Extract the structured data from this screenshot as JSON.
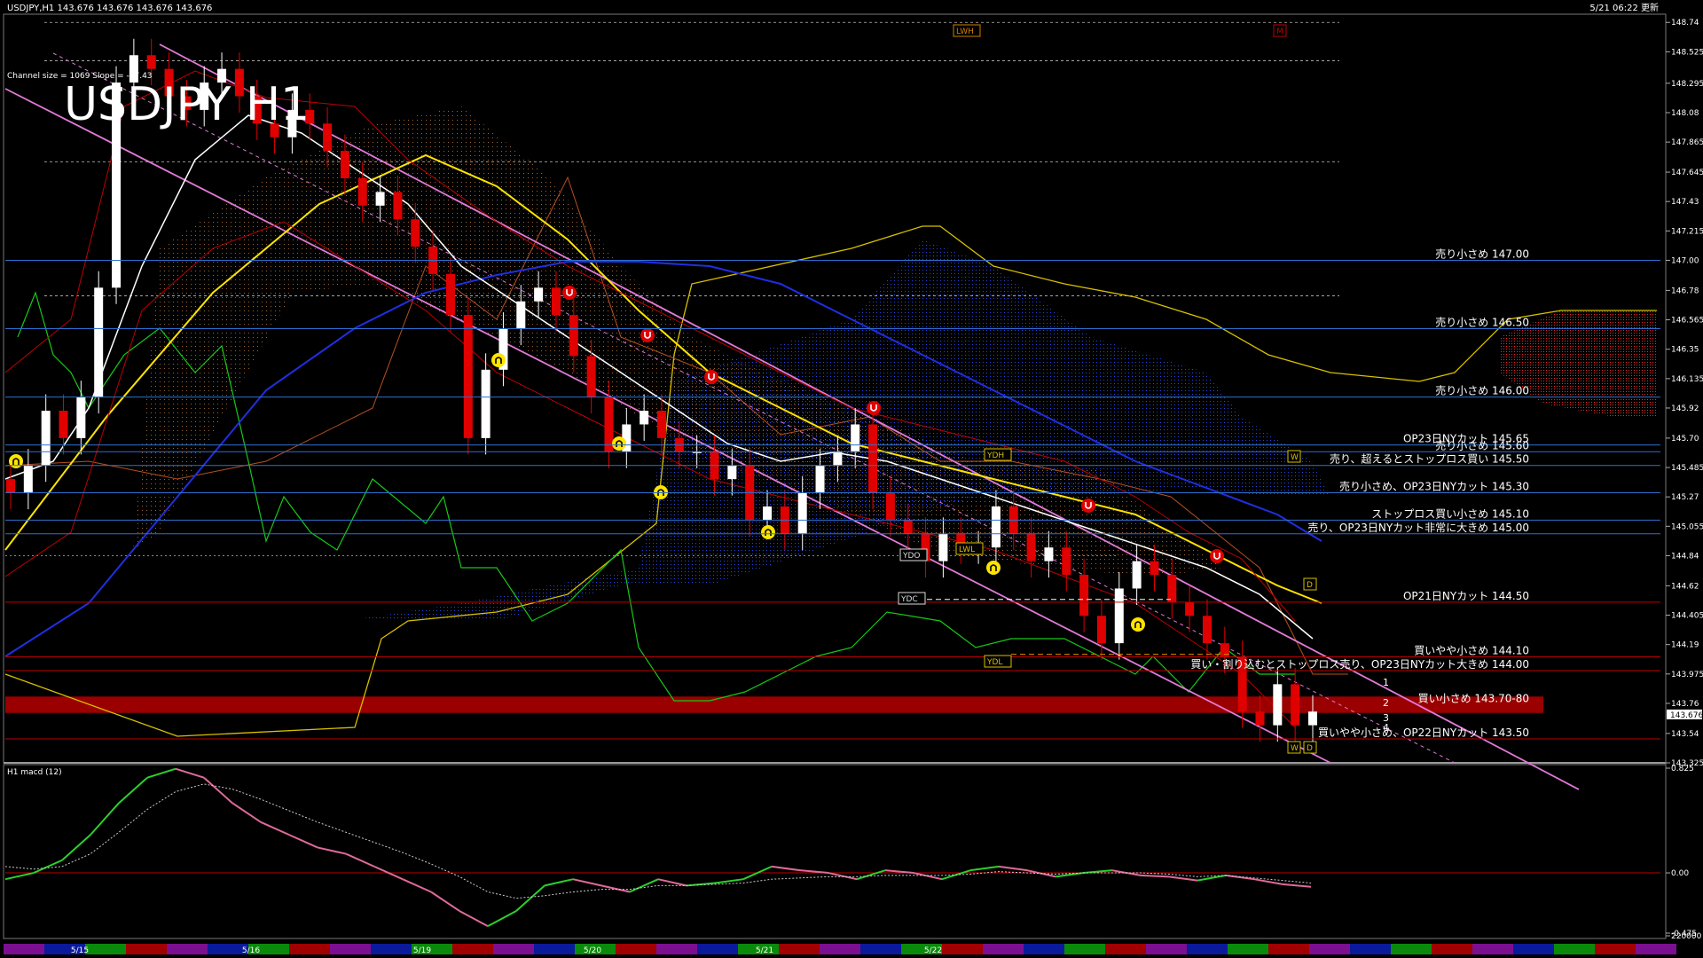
{
  "window": {
    "header_left": "USDJPY,H1  143.676 143.676 143.676 143.676",
    "header_right": "5/21 06:22 更新",
    "channel_info": "Channel size = 1069 Slope = -27.43",
    "big_title": "USDJPY H1"
  },
  "colors": {
    "background": "#000000",
    "candle_up": "#ffffff",
    "candle_down": "#e00000",
    "ma_yellow": "#ffe400",
    "ma_blue": "#1f2fe0",
    "ma_white": "#ffffff",
    "channel": "#e27ad8",
    "level_line": "#2e6fd0",
    "red_line": "#c00000",
    "zone": "#9a0000",
    "lagging": "#16c816",
    "macd_green": "#2bd12b",
    "macd_pink": "#e06a9a"
  },
  "chart_data": {
    "type": "candlestick",
    "symbol": "USDJPY",
    "timeframe": "H1",
    "ylim": [
      143.325,
      148.8
    ],
    "y_ticks": [
      148.74,
      148.525,
      148.295,
      148.08,
      147.865,
      147.645,
      147.43,
      147.215,
      147.0,
      146.78,
      146.565,
      146.35,
      146.135,
      145.92,
      145.7,
      145.485,
      145.27,
      145.055,
      144.84,
      144.62,
      144.405,
      144.19,
      143.975,
      143.76,
      143.54,
      143.325
    ],
    "current_price": "143.676",
    "x_date_labels": [
      "5/15",
      "5/16",
      "5/19",
      "5/20",
      "5/21",
      "5/22"
    ],
    "levels": [
      {
        "label": "売り小さめ 147.00",
        "price": 147.0
      },
      {
        "label": "売り小さめ 146.50",
        "price": 146.5
      },
      {
        "label": "売り小さめ 146.00",
        "price": 146.0
      },
      {
        "label": "OP23日NYカット 145.65",
        "price": 145.65
      },
      {
        "label": "売り小さめ 145.60",
        "price": 145.6
      },
      {
        "label": "売り、超えるとストップロス買い 145.50",
        "price": 145.5
      },
      {
        "label": "売り小さめ、OP23日NYカット 145.30",
        "price": 145.3
      },
      {
        "label": "ストップロス買い小さめ 145.10",
        "price": 145.1
      },
      {
        "label": "売り、OP23日NYカット非常に大きめ 145.00",
        "price": 145.0
      },
      {
        "label": "OP21日NYカット 144.50",
        "price": 144.5
      },
      {
        "label": "買いやや小さめ 144.10",
        "price": 144.1
      },
      {
        "label": "買い・割り込むとストップロス売り、OP23日NYカット大きめ 144.00",
        "price": 144.0
      },
      {
        "label": "買い小さめ 143.70-80",
        "price": 143.75
      },
      {
        "label": "買いやや小さめ、OP22日NYカット 143.50",
        "price": 143.5
      }
    ],
    "tags": [
      "LWH",
      "M",
      "YDH",
      "W",
      "YDO",
      "LWL",
      "YDC",
      "D",
      "YDL",
      "W",
      "D"
    ],
    "wave_labels": [
      "1",
      "2",
      "3",
      "4"
    ],
    "close_prices": [
      145.3,
      145.5,
      145.9,
      145.7,
      146.0,
      146.8,
      148.3,
      148.5,
      148.4,
      148.2,
      148.1,
      148.3,
      148.4,
      148.2,
      148.0,
      147.9,
      148.1,
      148.0,
      147.8,
      147.6,
      147.4,
      147.5,
      147.3,
      147.1,
      146.9,
      146.6,
      145.7,
      146.2,
      146.5,
      146.7,
      146.8,
      146.6,
      146.3,
      146.0,
      145.6,
      145.8,
      145.9,
      145.7,
      145.6,
      145.6,
      145.4,
      145.5,
      145.1,
      145.2,
      145.0,
      145.3,
      145.5,
      145.6,
      145.8,
      145.3,
      145.1,
      145.0,
      144.8,
      145.0,
      144.9,
      144.9,
      145.2,
      145.0,
      144.8,
      144.9,
      144.7,
      144.4,
      144.2,
      144.6,
      144.8,
      144.7,
      144.5,
      144.4,
      144.2,
      144.1,
      143.7,
      143.6,
      143.9,
      143.6,
      143.7
    ],
    "macd": {
      "title": "H1  macd (12)",
      "ylim": [
        -0.475,
        0.825
      ],
      "y_ticks": [
        0.825,
        0.0,
        -0.475,
        -220000
      ],
      "tick_labels": [
        "0.825",
        "0.00",
        "-0.475",
        "220000"
      ],
      "main": [
        -0.05,
        0.0,
        0.1,
        0.3,
        0.55,
        0.75,
        0.82,
        0.75,
        0.55,
        0.4,
        0.3,
        0.2,
        0.15,
        0.05,
        -0.05,
        -0.15,
        -0.3,
        -0.42,
        -0.3,
        -0.1,
        -0.05,
        -0.1,
        -0.15,
        -0.05,
        -0.1,
        -0.08,
        -0.05,
        0.05,
        0.02,
        0.0,
        -0.05,
        0.02,
        0.0,
        -0.05,
        0.02,
        0.05,
        0.02,
        -0.03,
        0.0,
        0.02,
        -0.02,
        -0.03,
        -0.06,
        -0.02,
        -0.05,
        -0.09,
        -0.11
      ],
      "signal": [
        0.05,
        0.03,
        0.05,
        0.15,
        0.32,
        0.5,
        0.64,
        0.7,
        0.66,
        0.58,
        0.49,
        0.4,
        0.32,
        0.24,
        0.16,
        0.07,
        -0.03,
        -0.15,
        -0.2,
        -0.18,
        -0.15,
        -0.13,
        -0.13,
        -0.1,
        -0.1,
        -0.09,
        -0.08,
        -0.05,
        -0.04,
        -0.03,
        -0.03,
        -0.02,
        -0.02,
        -0.02,
        -0.01,
        0.01,
        0.0,
        -0.01,
        0.0,
        0.0,
        0.0,
        -0.01,
        -0.03,
        -0.02,
        -0.04,
        -0.06,
        -0.08
      ]
    }
  }
}
